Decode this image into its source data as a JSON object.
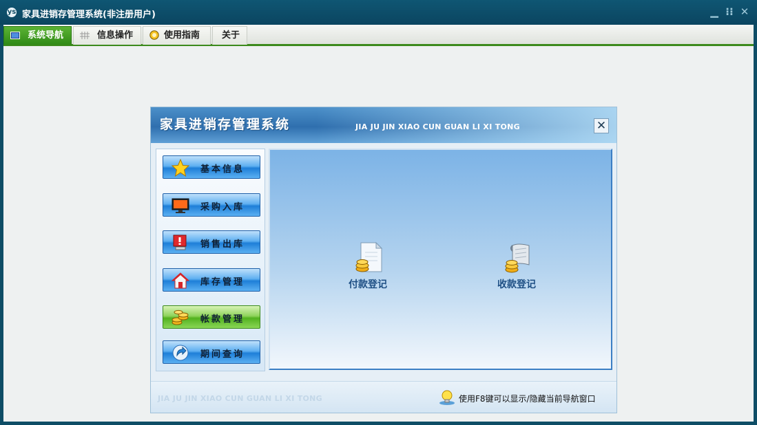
{
  "window": {
    "title": "家具进销存管理系统(非注册用户)",
    "icon": "app-logo-icon",
    "controls": [
      "minimize-icon",
      "restore-icon",
      "close-icon"
    ]
  },
  "tabs": [
    {
      "label": "系统导航",
      "icon": "monitor-icon",
      "active": true
    },
    {
      "label": "信息操作",
      "icon": "grid-icon",
      "active": false
    },
    {
      "label": "使用指南",
      "icon": "guide-icon",
      "active": false
    },
    {
      "label": "关于",
      "icon": "",
      "active": false
    }
  ],
  "dialog": {
    "title": "家具进销存管理系统",
    "subtitle": "JIA JU JIN XIAO CUN  GUAN LI XI TONG",
    "close_icon": "close-icon",
    "nav": [
      {
        "label": "基本信息",
        "icon": "star-icon",
        "active": false
      },
      {
        "label": "采购入库",
        "icon": "monitor-icon",
        "active": false
      },
      {
        "label": "销售出库",
        "icon": "alert-icon",
        "active": false
      },
      {
        "label": "库存管理",
        "icon": "house-icon",
        "active": false
      },
      {
        "label": "帐款管理",
        "icon": "coins-icon",
        "active": true
      },
      {
        "label": "期间查询",
        "icon": "arrow-circle-icon",
        "active": false
      }
    ],
    "functions": [
      {
        "label": "付款登记",
        "icon": "document-coins-icon"
      },
      {
        "label": "收款登记",
        "icon": "scroll-coins-icon"
      }
    ],
    "footer": {
      "left_text": "JIA JU JIN XIAO CUN GUAN LI XI TONG",
      "tip_icon": "lightbulb-icon",
      "tip_text": "使用F8键可以显示/隐藏当前导航窗口"
    }
  },
  "colors": {
    "titlebar": "#0e4d66",
    "tab_active": "#3c8a1c",
    "header_blue": "#2f6fae",
    "nav_button_blue": "#1e7fd8",
    "nav_button_green": "#52b21f"
  }
}
